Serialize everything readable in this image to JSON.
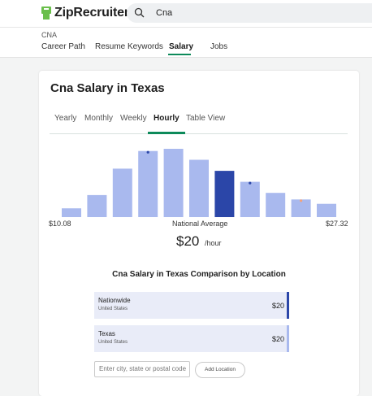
{
  "header": {
    "logo_text": "ZipRecruiter",
    "search_value": "Cna",
    "brand_color": "#6abf4b"
  },
  "subnav": {
    "breadcrumb": "CNA",
    "tabs": [
      {
        "label": "Career Path",
        "active": false
      },
      {
        "label": "Resume Keywords",
        "active": false
      },
      {
        "label": "Salary",
        "active": true
      },
      {
        "label": "Jobs",
        "active": false
      }
    ]
  },
  "card": {
    "title": "Cna Salary in Texas",
    "tabs": [
      {
        "label": "Yearly",
        "active": false
      },
      {
        "label": "Monthly",
        "active": false
      },
      {
        "label": "Weekly",
        "active": false
      },
      {
        "label": "Hourly",
        "active": true
      },
      {
        "label": "Table View",
        "active": false
      }
    ],
    "min_label": "$10.08",
    "avg_label": "National Average",
    "max_label": "$27.32",
    "salary_value": "$20",
    "salary_unit": "/hour"
  },
  "chart_data": {
    "type": "bar",
    "title": "",
    "values": [
      2,
      5,
      11,
      15,
      15.5,
      13,
      10.5,
      8,
      5.5,
      4,
      3
    ],
    "highlight_index": 6,
    "bar_color": "#a9b9ee",
    "highlight_color": "#2b46a8",
    "markers": [
      {
        "bar": 3,
        "color": "#2b46a8"
      },
      {
        "bar": 7,
        "color": "#2b46a8"
      },
      {
        "bar": 9,
        "color": "#f4a27a"
      }
    ],
    "x_range_labels": [
      "$10.08",
      "$27.32"
    ]
  },
  "comparison": {
    "title": "Cna Salary in Texas Comparison by Location",
    "rows": [
      {
        "name": "Nationwide",
        "sub": "United States",
        "value": "$20",
        "edge_color": "#2b46a8"
      },
      {
        "name": "Texas",
        "sub": "United States",
        "value": "$20",
        "edge_color": "#a9b9ee"
      }
    ],
    "input_placeholder": "Enter city, state or postal code",
    "add_button": "Add Location"
  }
}
